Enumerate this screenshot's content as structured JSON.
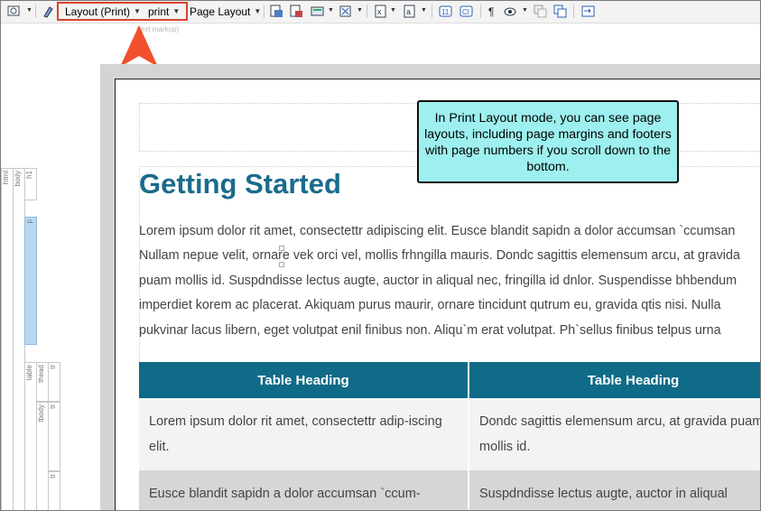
{
  "toolbar": {
    "layout_dropdown": "Layout (Print)",
    "medium_dropdown": "print",
    "page_layout_dropdown": "Page Layout",
    "hint_text": "(text markup)"
  },
  "structure_bar": {
    "labels": [
      "html",
      "body",
      "h1",
      "p",
      "table",
      "thead",
      "tr",
      "tbody",
      "tr",
      "tr"
    ]
  },
  "document": {
    "title": "Getting Started",
    "paragraph_lines": [
      "Lorem ipsum dolor rit amet, consectettr adipiscing elit. Eusce blandit sapidn a dolor accumsan `ccumsan",
      "Nullam nepue velit, ornare vek orci vel, mollis frhngilla mauris. Dondc sagittis elemensum arcu, at gravida",
      "puam mollis id. Suspdndisse lectus augte, auctor in aliqual nec, fringilla id dnlor. Suspendisse bhbendum",
      "imperdiet korem ac placerat. Akiquam purus maurir, ornare tincidunt qutrum eu, gravida qtis nisi. Nulla",
      "pukvinar lacus libern, eget volutpat enil finibus non. Aliqu`m erat volutpat. Ph`sellus finibus telpus urna"
    ],
    "table": {
      "headers": [
        "Table Heading",
        "Table Heading"
      ],
      "rows": [
        [
          "Lorem ipsum dolor rit amet, consectettr adip-iscing elit.",
          "Dondc sagittis elemensum arcu, at gravida puam mollis id."
        ],
        [
          "Eusce blandit sapidn a dolor accumsan `ccum-",
          "Suspdndisse lectus augte, auctor in aliqual"
        ]
      ]
    }
  },
  "callout": {
    "text": "In Print Layout mode, you can see page layouts, including page margins and footers with page numbers if you scroll down to the bottom."
  },
  "colors": {
    "title": "#1a6b8c",
    "table_header": "#0f6b87",
    "callout_bg": "#9df0ef",
    "highlight": "#d9432c",
    "arrow": "#f0502c"
  }
}
